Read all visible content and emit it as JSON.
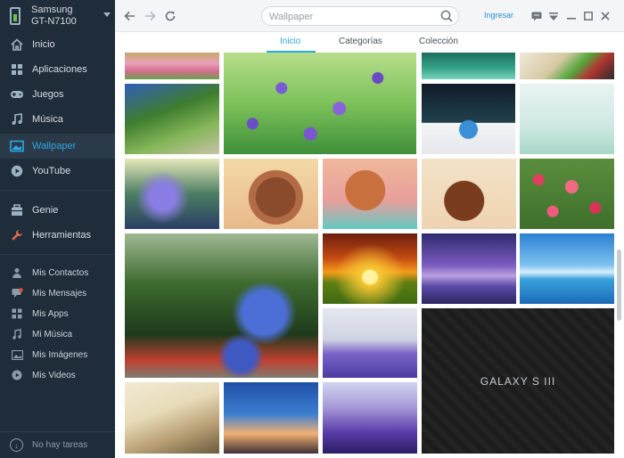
{
  "device": {
    "brand": "Samsung",
    "model": "GT-N7100"
  },
  "nav": {
    "main": [
      {
        "label": "Inicio",
        "icon": "home-icon",
        "active": false
      },
      {
        "label": "Aplicaciones",
        "icon": "apps-grid-icon",
        "active": false
      },
      {
        "label": "Juegos",
        "icon": "gamepad-icon",
        "active": false
      },
      {
        "label": "Música",
        "icon": "music-note-icon",
        "active": false
      },
      {
        "label": "Wallpaper",
        "icon": "wallpaper-icon",
        "active": true
      },
      {
        "label": "YouTube",
        "icon": "play-icon",
        "active": false
      }
    ],
    "tools": [
      {
        "label": "Genie",
        "icon": "genie-icon"
      },
      {
        "label": "Herramientas",
        "icon": "wrench-icon"
      }
    ],
    "mine": [
      {
        "label": "Mis Contactos",
        "icon": "contacts-icon"
      },
      {
        "label": "Mis Mensajes",
        "icon": "messages-icon"
      },
      {
        "label": "Mis Apps",
        "icon": "my-apps-icon"
      },
      {
        "label": "Mi Música",
        "icon": "my-music-icon"
      },
      {
        "label": "Mis Imágenes",
        "icon": "images-icon"
      },
      {
        "label": "Mis Videos",
        "icon": "videos-icon"
      }
    ]
  },
  "tasks": {
    "label": "No hay tareas",
    "icon": "download-icon"
  },
  "toolbar": {
    "search_placeholder": "Wallpaper",
    "login_label": "Ingresar"
  },
  "tabs": [
    {
      "label": "Inicio",
      "active": true
    },
    {
      "label": "Categorías",
      "active": false
    },
    {
      "label": "Colección",
      "active": false
    }
  ],
  "galaxy_label": "GALAXY S III",
  "colors": {
    "accent": "#2fa8e6",
    "sidebar": "#1f2d3a",
    "sidebar_active": "#2a3a49"
  }
}
